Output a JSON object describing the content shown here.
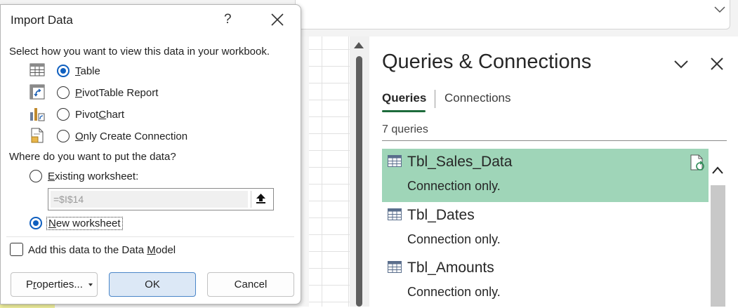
{
  "dialog": {
    "title": "Import Data",
    "help": "?",
    "view_prompt": "Select how you want to view this data in your workbook.",
    "view_options": [
      {
        "pre": "",
        "key": "T",
        "post": "able",
        "selected": true,
        "icon": "table-icon"
      },
      {
        "pre": "",
        "key": "P",
        "post": "ivotTable Report",
        "selected": false,
        "icon": "pivottable-icon"
      },
      {
        "pre": "Pivot",
        "key": "C",
        "post": "hart",
        "selected": false,
        "icon": "pivotchart-icon"
      },
      {
        "pre": "",
        "key": "O",
        "post": "nly Create Connection",
        "selected": false,
        "icon": "connection-only-icon"
      }
    ],
    "location_prompt": "Where do you want to put the data?",
    "existing": {
      "pre": "",
      "key": "E",
      "post": "xisting worksheet:",
      "selected": false
    },
    "cell_reference": "=$I$14",
    "new_ws": {
      "pre": "",
      "key": "N",
      "post": "ew worksheet",
      "selected": true
    },
    "data_model": {
      "pre": "Add this data to the Data ",
      "key": "M",
      "post": "odel",
      "checked": false
    },
    "buttons": {
      "properties": {
        "pre": "P",
        "key": "r",
        "post": "operties..."
      },
      "ok": "OK",
      "cancel": "Cancel"
    }
  },
  "queries_pane": {
    "title": "Queries & Connections",
    "tabs": [
      {
        "label": "Queries",
        "active": true
      },
      {
        "label": "Connections",
        "active": false
      }
    ],
    "count_label": "7 queries",
    "items": [
      {
        "name": "Tbl_Sales_Data",
        "status": "Connection only.",
        "selected": true
      },
      {
        "name": "Tbl_Dates",
        "status": "Connection only.",
        "selected": false
      },
      {
        "name": "Tbl_Amounts",
        "status": "Connection only.",
        "selected": false
      }
    ]
  },
  "colors": {
    "accent_green": "#1d6b3b",
    "selected_row": "#9fd5b8",
    "radio_blue": "#0f5fbf"
  }
}
